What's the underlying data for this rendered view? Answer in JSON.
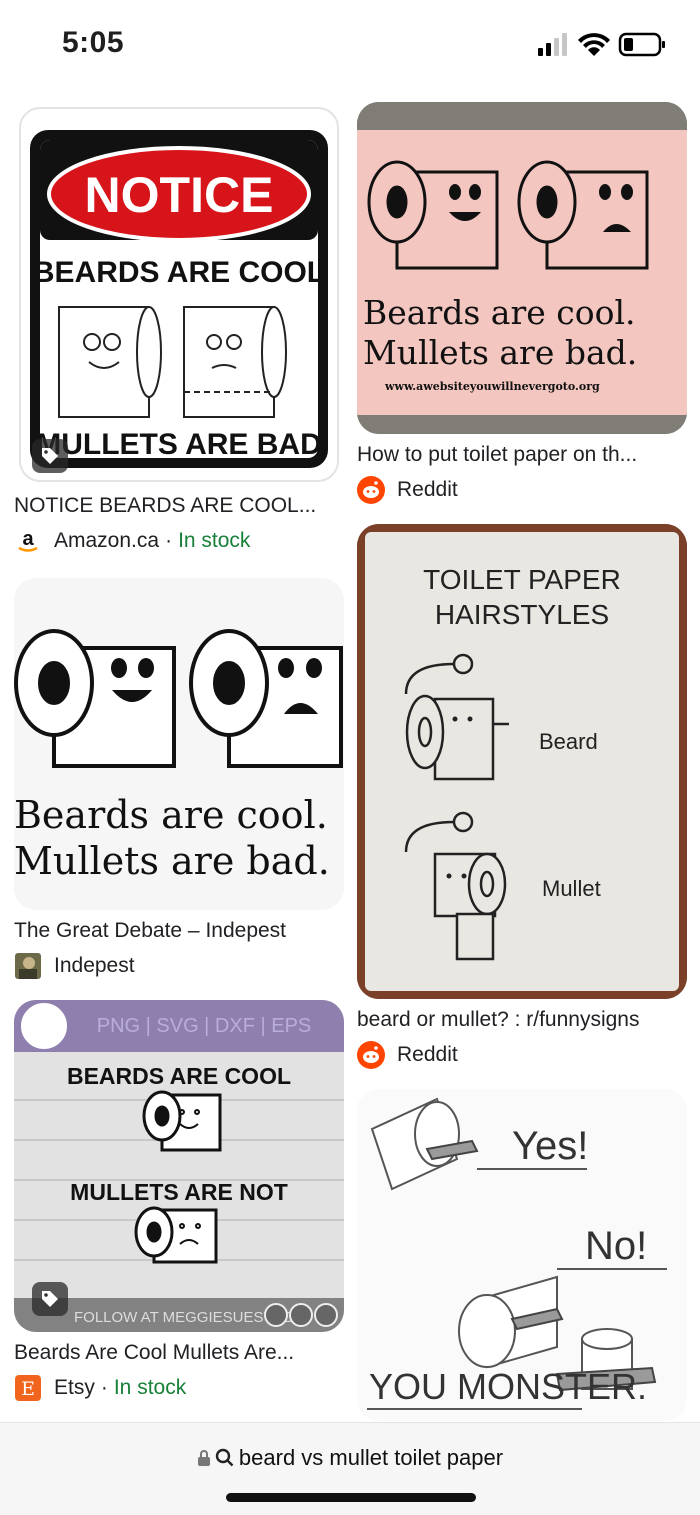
{
  "status": {
    "time": "5:05"
  },
  "results": {
    "left": [
      {
        "title": "NOTICE BEARDS ARE COOL...",
        "source": "Amazon.ca",
        "stock": "In stock",
        "image_text": {
          "notice": "NOTICE",
          "top": "BEARDS ARE COOL",
          "bottom": "MULLETS ARE BAD"
        }
      },
      {
        "title": "The Great Debate – Indepest",
        "source": "Indepest",
        "image_text": {
          "line1": "Beards are cool.",
          "line2": "Mullets are bad."
        }
      },
      {
        "title": "Beards Are Cool Mullets Are...",
        "source": "Etsy",
        "stock": "In stock",
        "image_text": {
          "banner": "PNG | SVG | DXF | EPS",
          "top": "BEARDS ARE COOL",
          "bottom": "MULLETS ARE NOT",
          "footer": "FOLLOW AT MEGGIESUESTUDIO"
        }
      }
    ],
    "right": [
      {
        "title": "How to put toilet paper on th...",
        "source": "Reddit",
        "image_text": {
          "line1": "Beards are cool.",
          "line2": "Mullets are bad.",
          "url": "www.awebsiteyouwillnevergoto.org"
        }
      },
      {
        "title": "beard or mullet? : r/funnysigns",
        "source": "Reddit",
        "image_text": {
          "title1": "TOILET PAPER",
          "title2": "HAIRSTYLES",
          "beard": "Beard",
          "mullet": "Mullet"
        }
      },
      {
        "image_text": {
          "yes": "Yes!",
          "no": "No!",
          "monster": "YOU MONSTER."
        }
      }
    ]
  },
  "separator": "·",
  "search": {
    "query": "beard vs mullet toilet paper"
  },
  "colors": {
    "reddit": "#ff4500",
    "etsy": "#f1641e",
    "stock": "#188038",
    "notice_red": "#d7141a"
  }
}
